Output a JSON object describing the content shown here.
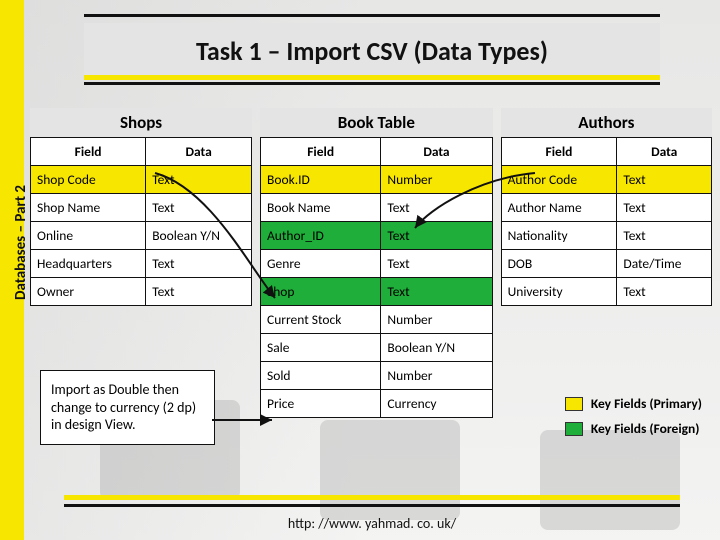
{
  "sidebar": {
    "label": "Databases – Part 2"
  },
  "title": "Task 1 – Import CSV (Data Types)",
  "columns": {
    "field": "Field",
    "data": "Data"
  },
  "tables": {
    "shops": {
      "title": "Shops",
      "rows": [
        {
          "field": "Shop Code",
          "data": "Text",
          "hl": "yellow"
        },
        {
          "field": "Shop Name",
          "data": "Text",
          "hl": ""
        },
        {
          "field": "Online",
          "data": "Boolean Y/N",
          "hl": ""
        },
        {
          "field": "Headquarters",
          "data": "Text",
          "hl": ""
        },
        {
          "field": "Owner",
          "data": "Text",
          "hl": ""
        }
      ]
    },
    "book": {
      "title": "Book Table",
      "rows": [
        {
          "field": "Book.ID",
          "data": "Number",
          "hl": "yellow"
        },
        {
          "field": "Book Name",
          "data": "Text",
          "hl": ""
        },
        {
          "field": "Author_ID",
          "data": "Text",
          "hl": "green"
        },
        {
          "field": "Genre",
          "data": "Text",
          "hl": ""
        },
        {
          "field": "Shop",
          "data": "Text",
          "hl": "green"
        },
        {
          "field": "Current Stock",
          "data": "Number",
          "hl": ""
        },
        {
          "field": "Sale",
          "data": "Boolean Y/N",
          "hl": ""
        },
        {
          "field": "Sold",
          "data": "Number",
          "hl": ""
        },
        {
          "field": "Price",
          "data": "Currency",
          "hl": ""
        }
      ]
    },
    "authors": {
      "title": "Authors",
      "rows": [
        {
          "field": "Author Code",
          "data": "Text",
          "hl": "yellow"
        },
        {
          "field": "Author Name",
          "data": "Text",
          "hl": ""
        },
        {
          "field": "Nationality",
          "data": "Text",
          "hl": ""
        },
        {
          "field": "DOB",
          "data": "Date/Time",
          "hl": ""
        },
        {
          "field": "University",
          "data": "Text",
          "hl": ""
        }
      ]
    }
  },
  "note": "Import as Double then change to currency (2 dp) in design View.",
  "legend": {
    "primary": "Key Fields (Primary)",
    "foreign": "Key Fields (Foreign)"
  },
  "footer_url": "http: //www. yahmad. co. uk/"
}
